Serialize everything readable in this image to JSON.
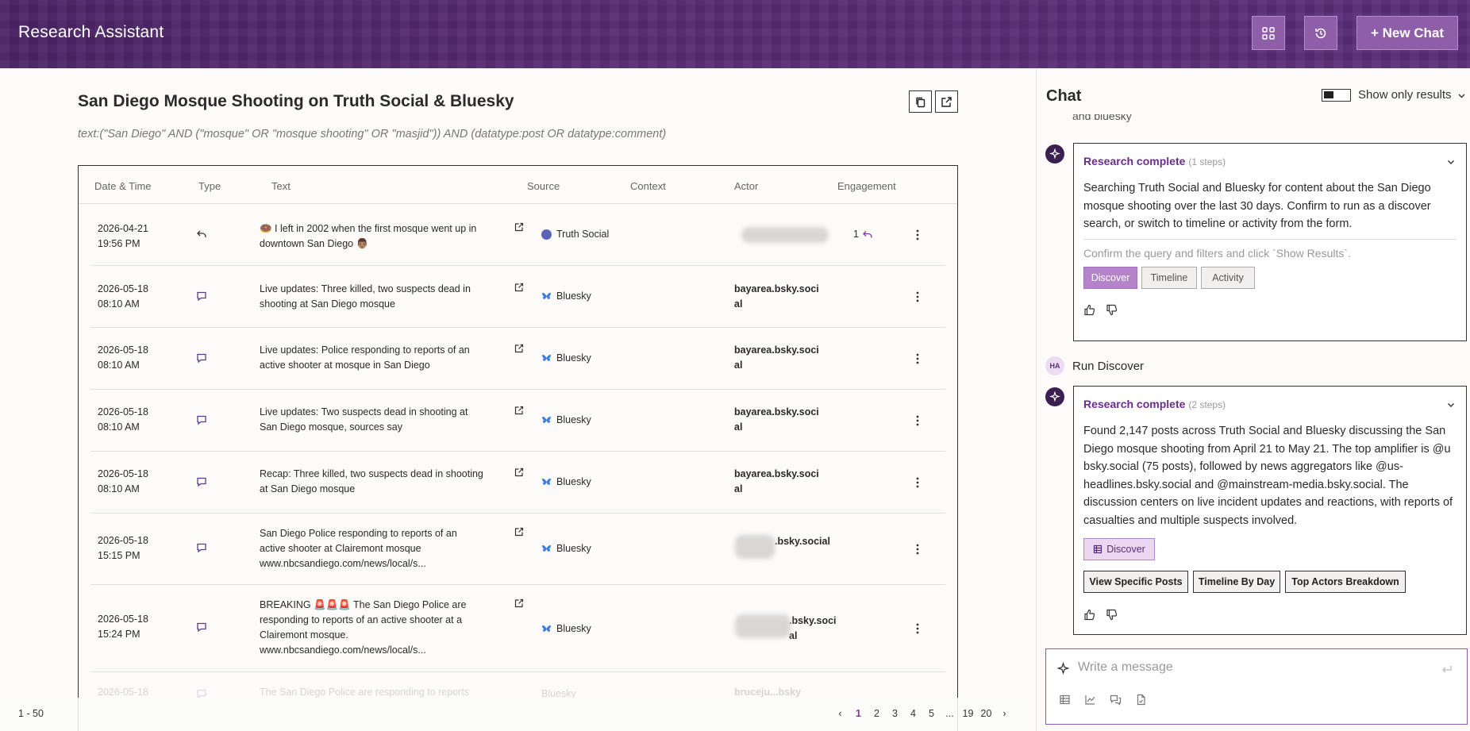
{
  "header": {
    "app_title": "Research Assistant",
    "new_chat_label": "+ New Chat"
  },
  "main": {
    "title": "San Diego Mosque Shooting on Truth Social & Bluesky",
    "query": "text:(\"San Diego\" AND (\"mosque\" OR \"mosque shooting\" OR \"masjid\")) AND (datatype:post OR datatype:comment)",
    "columns": [
      "Date & Time",
      "Type",
      "Text",
      "Source",
      "Context",
      "Actor",
      "Engagement"
    ],
    "rows": [
      {
        "date": "2026-04-21",
        "time": "19:56 PM",
        "type": "reply",
        "text": "🍩 I left in 2002 when the first mosque went up in downtown San Diego 👨🏽",
        "source": "Truth Social",
        "actor": "",
        "engagement": "1"
      },
      {
        "date": "2026-05-18",
        "time": "08:10 AM",
        "type": "comment",
        "text": "Live updates: Three killed, two suspects dead in shooting at San Diego mosque",
        "source": "Bluesky",
        "actor": "bayarea.bsky.social",
        "engagement": ""
      },
      {
        "date": "2026-05-18",
        "time": "08:10 AM",
        "type": "comment",
        "text": "Live updates: Police responding to reports of an active shooter at mosque in San Diego",
        "source": "Bluesky",
        "actor": "bayarea.bsky.social",
        "engagement": ""
      },
      {
        "date": "2026-05-18",
        "time": "08:10 AM",
        "type": "comment",
        "text": "Live updates: Two suspects dead in shooting at San Diego mosque, sources say",
        "source": "Bluesky",
        "actor": "bayarea.bsky.social",
        "engagement": ""
      },
      {
        "date": "2026-05-18",
        "time": "08:10 AM",
        "type": "comment",
        "text": "Recap: Three killed, two suspects dead in shooting at San Diego mosque",
        "source": "Bluesky",
        "actor": "bayarea.bsky.social",
        "engagement": ""
      },
      {
        "date": "2026-05-18",
        "time": "15:15 PM",
        "type": "comment",
        "text": "San Diego Police responding to reports of an active shooter at Clairemont mosque www.nbcsandiego.com/news/local/s...",
        "source": "Bluesky",
        "actor": ".bsky.social",
        "engagement": ""
      },
      {
        "date": "2026-05-18",
        "time": "15:24 PM",
        "type": "comment",
        "text": "BREAKING 🚨🚨🚨 The San Diego Police are responding to reports of an active shooter at a Clairemont mosque. www.nbcsandiego.com/news/local/s...",
        "source": "Bluesky",
        "actor": ".bsky.social",
        "engagement": ""
      },
      {
        "date": "2026-05-18",
        "time": "",
        "type": "comment",
        "text": "The San Diego Police are responding to reports",
        "source": "Bluesky",
        "actor": "bruceju...bsky",
        "engagement": ""
      }
    ],
    "range": "1 - 50",
    "pages": [
      "1",
      "2",
      "3",
      "4",
      "5",
      "...",
      "19",
      "20"
    ]
  },
  "chat": {
    "title": "Chat",
    "toggle_label": "Show only results",
    "cutoff_text": "and bluesky",
    "card1": {
      "title": "Research complete",
      "steps": "(1 steps)",
      "body": "Searching Truth Social and Bluesky for content about the San Diego mosque shooting over the last 30 days. Confirm to run as a discover search, or switch to timeline or activity from the form.",
      "hint": "Confirm the query and filters and click `Show Results`.",
      "options": [
        "Discover",
        "Timeline",
        "Activity"
      ]
    },
    "user_avatar": "HA",
    "user_message": "Run Discover",
    "card2": {
      "title": "Research complete",
      "steps": "(2 steps)",
      "body": "Found 2,147 posts across Truth Social and Bluesky discussing the San Diego mosque shooting from April 21 to May 21. The top amplifier is @u bsky.social (75 posts), followed by news aggregators like @us-headlines.bsky.social and @mainstream-media.bsky.social. The discussion centers on live incident updates and reactions, with reports of casualties and multiple suspects involved.",
      "result_chip": "Discover",
      "actions": [
        "View Specific Posts",
        "Timeline By Day",
        "Top Actors Breakdown"
      ]
    },
    "composer_placeholder": "Write a message"
  },
  "colors": {
    "header_bg": "#552a72",
    "accent": "#6a2d8a",
    "chip_primary": "#b483c8"
  }
}
